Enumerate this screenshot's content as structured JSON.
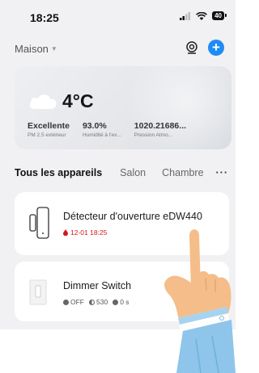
{
  "status_bar": {
    "time": "18:25",
    "battery": "40"
  },
  "header": {
    "home_name": "Maison"
  },
  "weather": {
    "temperature": "4°C",
    "metrics": [
      {
        "value": "Excellente",
        "label": "PM 2.5 extérieur"
      },
      {
        "value": "93.0%",
        "label": "Humidité à l'ex..."
      },
      {
        "value": "1020.21686...",
        "label": "Pression Atmo..."
      }
    ]
  },
  "tabs": [
    "Tous les appareils",
    "Salon",
    "Chambre"
  ],
  "devices": [
    {
      "name": "Détecteur d'ouverture eDW440",
      "status": "12-01 18:25"
    },
    {
      "name": "Dimmer Switch",
      "stats": [
        "OFF",
        "530",
        "0 s"
      ]
    }
  ],
  "colors": {
    "accent": "#1e8cf4",
    "alert": "#d4161c",
    "background": "#f1f1f3"
  },
  "icons": [
    "signal-icon",
    "wifi-icon",
    "battery-icon",
    "dropdown-caret-icon",
    "target-icon",
    "add-icon",
    "cloud-icon",
    "more-icon",
    "door-sensor-icon",
    "alert-drop-icon",
    "dimmer-switch-icon",
    "pointing-hand-icon"
  ]
}
